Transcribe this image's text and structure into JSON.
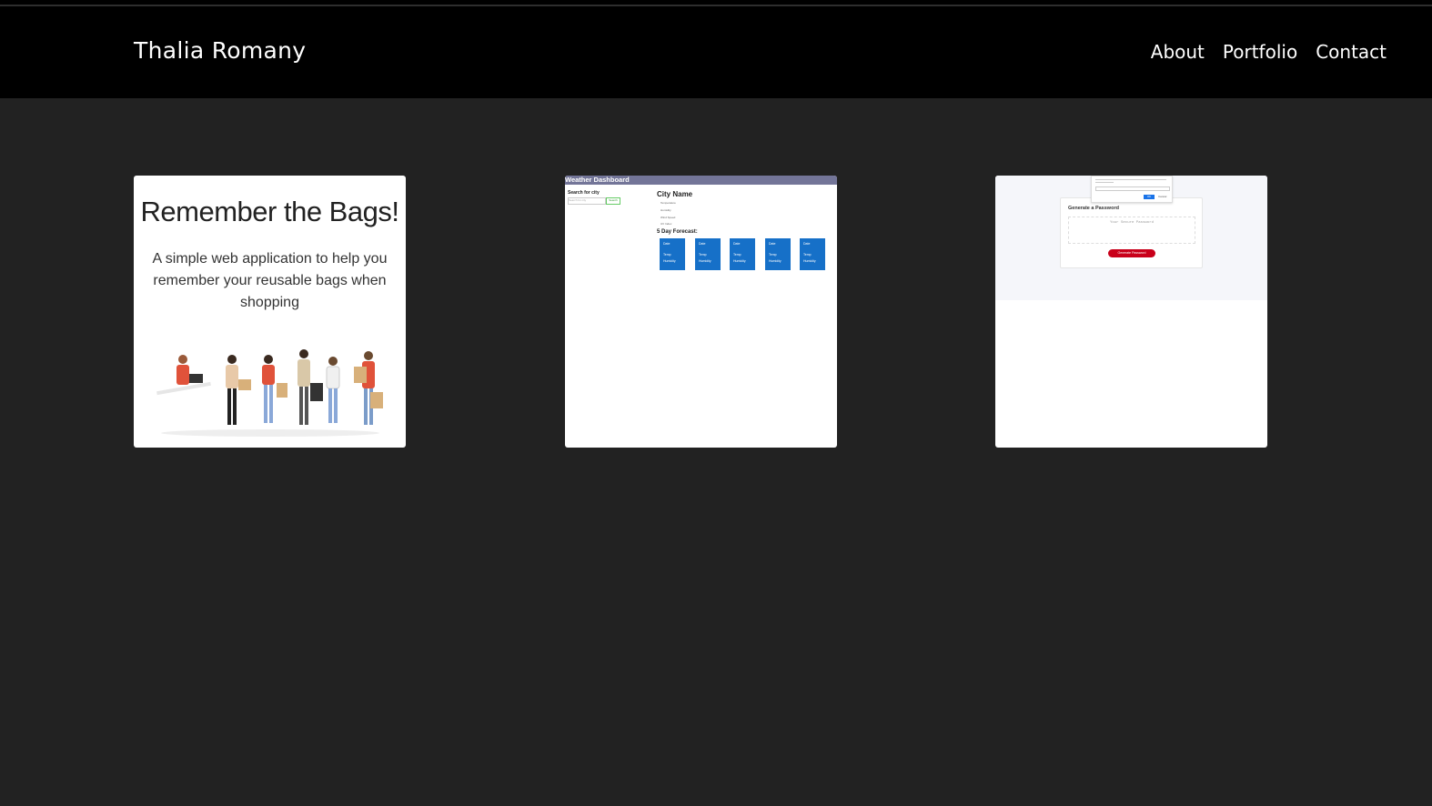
{
  "header": {
    "brand": "Thalia Romany",
    "nav": [
      "About",
      "Portfolio",
      "Contact"
    ]
  },
  "projects": [
    {
      "title": "Remember the Bags!",
      "description": "A simple web application to help you remember your reusable bags when shopping"
    },
    {
      "app_title": "Weather Dashboard",
      "search_label": "Search for city",
      "search_placeholder": "Search for city",
      "search_button": "Search",
      "city_name": "City Name",
      "stats": [
        "Temperature",
        "Humidity",
        "Wind Speed",
        "UV Index"
      ],
      "forecast_title": "5 Day Forecast:",
      "days": [
        {
          "date": "Date",
          "temp": "Temp",
          "humidity": "Humidity"
        },
        {
          "date": "Date",
          "temp": "Temp",
          "humidity": "Humidity"
        },
        {
          "date": "Date",
          "temp": "Temp",
          "humidity": "Humidity"
        },
        {
          "date": "Date",
          "temp": "Temp",
          "humidity": "Humidity"
        },
        {
          "date": "Date",
          "temp": "Temp",
          "humidity": "Humidity"
        }
      ]
    },
    {
      "popup_ok": "OK",
      "popup_cancel": "Cancel",
      "title": "Generate a Password",
      "placeholder": "Your Secure Password",
      "button": "Generate Password"
    }
  ],
  "colors": {
    "background": "#222222",
    "header": "#000000",
    "weather_accent": "#1670c8",
    "password_button": "#c9001a"
  }
}
